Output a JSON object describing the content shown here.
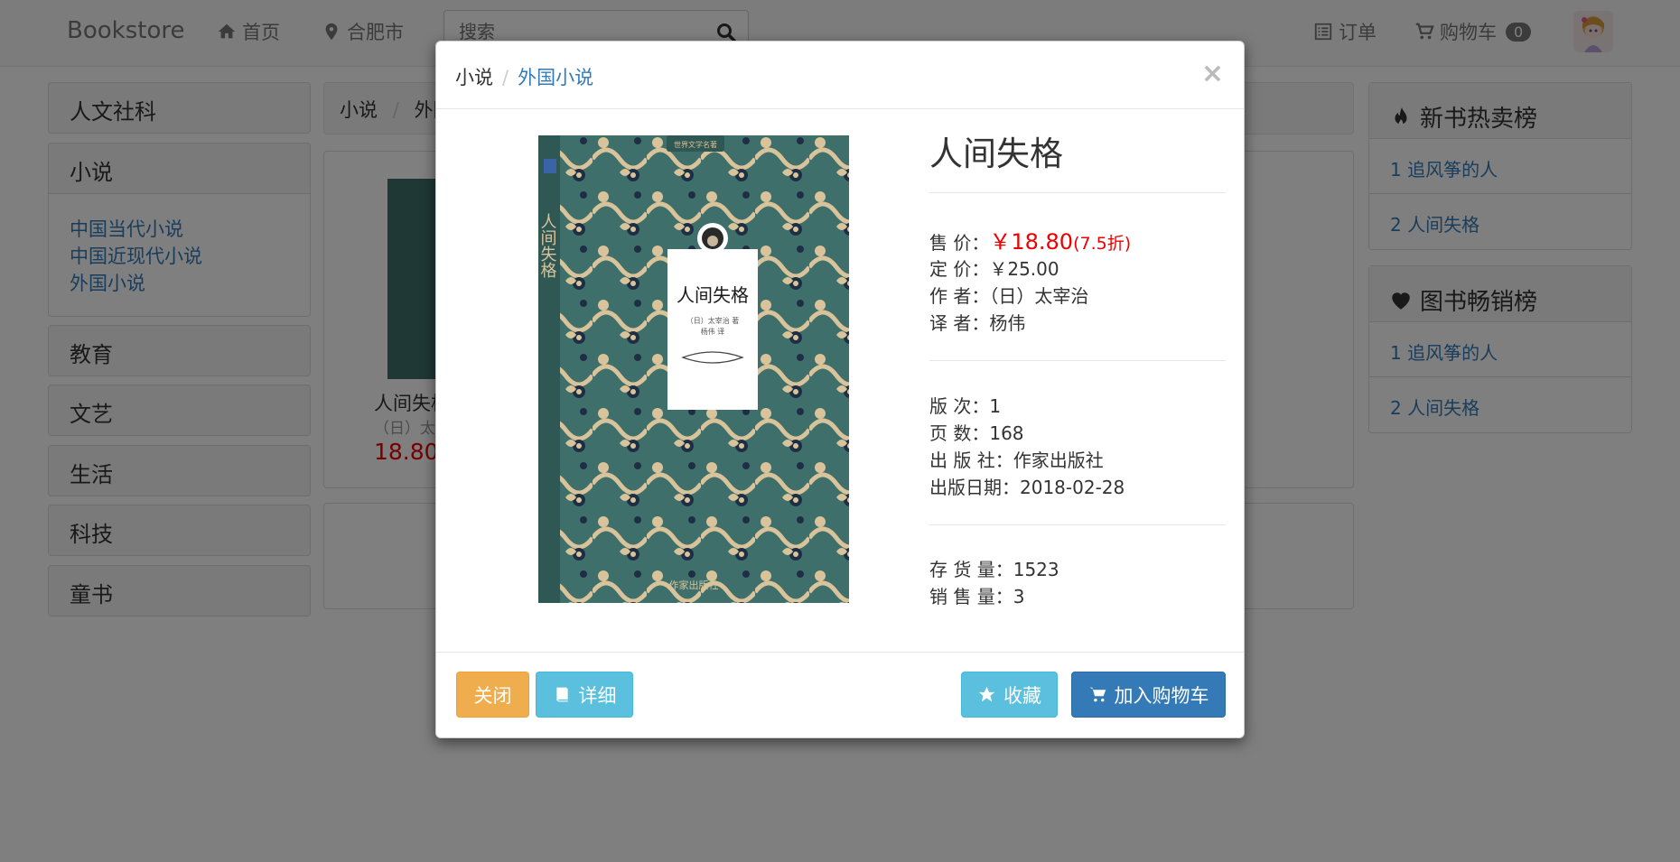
{
  "navbar": {
    "brand": "Bookstore",
    "home": "首页",
    "city": "合肥市",
    "search_placeholder": "搜索",
    "orders": "订单",
    "cart": "购物车",
    "cart_count": "0"
  },
  "sidebar": {
    "categories": [
      "人文社科",
      "小说",
      "教育",
      "文艺",
      "生活",
      "科技",
      "童书"
    ],
    "sub_items": [
      "中国当代小说",
      "中国近现代小说",
      "外国小说"
    ]
  },
  "main": {
    "crumb_1": "小说",
    "crumb_2": "外国",
    "book_title_partial": "人间失格",
    "book_author_partial": "（日）太",
    "book_price_partial": "18.80"
  },
  "rankings": {
    "new_hot_title": "新书热卖榜",
    "new_hot_items": [
      "1 追风筝的人",
      "2 人间失格"
    ],
    "bestseller_title": "图书畅销榜",
    "bestseller_items": [
      "1 追风筝的人",
      "2 人间失格"
    ]
  },
  "modal": {
    "crumb_parent": "小说",
    "crumb_current": "外国小说",
    "close_symbol": "×",
    "title": "人间失格",
    "price_label": "售 价：",
    "price": "￥18.80",
    "discount": "(7.5折)",
    "list_price_label": "定 价：",
    "list_price": "￥25.00",
    "author_label": "作 者：",
    "author": "（日）太宰治",
    "translator_label": "译 者：",
    "translator": "杨伟",
    "edition_label": "版 次：",
    "edition": "1",
    "pages_label": "页 数：",
    "pages": "168",
    "publisher_label": "出 版 社：",
    "publisher": "作家出版社",
    "pub_date_label": "出版日期：",
    "pub_date": "2018-02-28",
    "stock_label": "存 货 量：",
    "stock": "1523",
    "sales_label": "销 售 量：",
    "sales": "3",
    "btn_close": "关闭",
    "btn_detail": "详细",
    "btn_favorite": "收藏",
    "btn_add_cart": "加入购物车",
    "cover": {
      "series_text": "世界文学名著",
      "title_text": "人间失格",
      "author_text": "（日）太宰治 著",
      "translator_text": "杨伟 译",
      "publisher_text": "作家出版社",
      "colors": {
        "teal": "#3e6f6b",
        "cream": "#d9c39a",
        "navy": "#1e2f45"
      }
    }
  },
  "colors": {
    "link": "#337ab7",
    "price": "#ee0000",
    "warning": "#f0ad4e",
    "info": "#5bc0de",
    "primary": "#337ab7"
  }
}
